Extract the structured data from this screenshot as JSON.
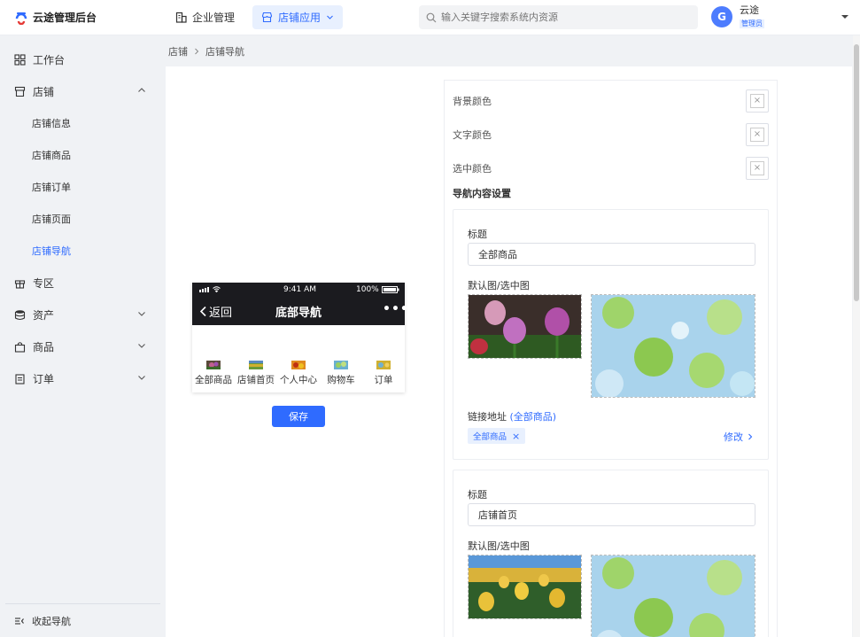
{
  "app": {
    "title": "云途管理后台"
  },
  "topnav": [
    {
      "label": "企业管理",
      "icon": "building-icon",
      "active": false
    },
    {
      "label": "店铺应用",
      "icon": "store-icon",
      "active": true
    }
  ],
  "search": {
    "placeholder": "输入关键字搜索系统内资源"
  },
  "user": {
    "initial": "G",
    "name": "云途",
    "role": "管理员"
  },
  "sidebar": {
    "items": [
      {
        "label": "工作台",
        "icon": "grid-icon"
      },
      {
        "label": "店铺",
        "icon": "shop-icon",
        "expanded": true
      },
      {
        "label": "专区",
        "icon": "gift-icon"
      },
      {
        "label": "资产",
        "icon": "database-icon"
      },
      {
        "label": "商品",
        "icon": "bag-icon"
      },
      {
        "label": "订单",
        "icon": "clipboard-icon"
      }
    ],
    "sub_items": [
      "店铺信息",
      "店铺商品",
      "店铺订单",
      "店铺页面",
      "店铺导航"
    ],
    "active_sub": "店铺导航",
    "collapse_label": "收起导航"
  },
  "breadcrumb": {
    "parent": "店铺",
    "current": "店铺导航"
  },
  "phone": {
    "time": "9:41 AM",
    "battery": "100%",
    "back_label": "返回",
    "title": "底部导航",
    "more": "•••",
    "tabs": [
      {
        "label": "全部商品"
      },
      {
        "label": "店铺首页"
      },
      {
        "label": "个人中心"
      },
      {
        "label": "购物车"
      },
      {
        "label": "订单"
      }
    ]
  },
  "save_label": "保存",
  "settings": {
    "color_rows": [
      {
        "label": "背景颜色"
      },
      {
        "label": "文字颜色"
      },
      {
        "label": "选中颜色"
      }
    ],
    "clear_glyph": "×",
    "section_title": "导航内容设置",
    "nav_items": [
      {
        "title_label": "标题",
        "title_value": "全部商品",
        "image_label": "默认图/选中图",
        "link_label": "链接地址",
        "link_target": "(全部商品)",
        "tag": "全部商品",
        "modify_label": "修改"
      },
      {
        "title_label": "标题",
        "title_value": "店铺首页",
        "image_label": "默认图/选中图"
      }
    ]
  },
  "colors": {
    "accent": "#2f6bff",
    "phone_header": "#1b1b1f"
  }
}
